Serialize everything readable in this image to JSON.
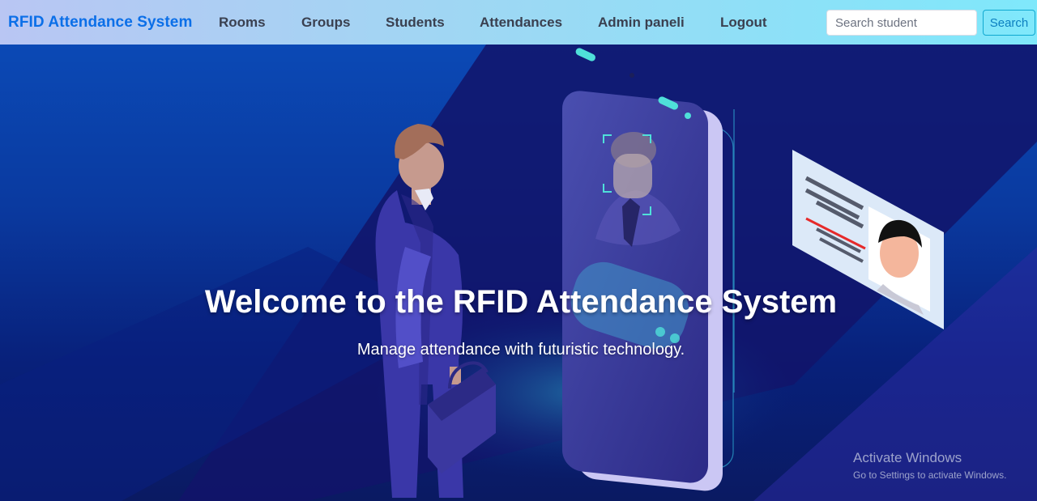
{
  "nav": {
    "brand": "RFID Attendance System",
    "links": [
      "Rooms",
      "Groups",
      "Students",
      "Attendances",
      "Admin paneli",
      "Logout"
    ],
    "search_placeholder": "Search student",
    "search_button": "Search"
  },
  "hero": {
    "title": "Welcome to the RFID Attendance System",
    "subtitle": "Manage attendance with futuristic technology."
  },
  "watermark": {
    "title": "Activate Windows",
    "subtitle": "Go to Settings to activate Windows."
  },
  "colors": {
    "brand": "#0b6fe8",
    "nav_text": "#3a4050",
    "hero_bg": "#0a3aa0",
    "accent_cyan": "#3ee0d8"
  }
}
